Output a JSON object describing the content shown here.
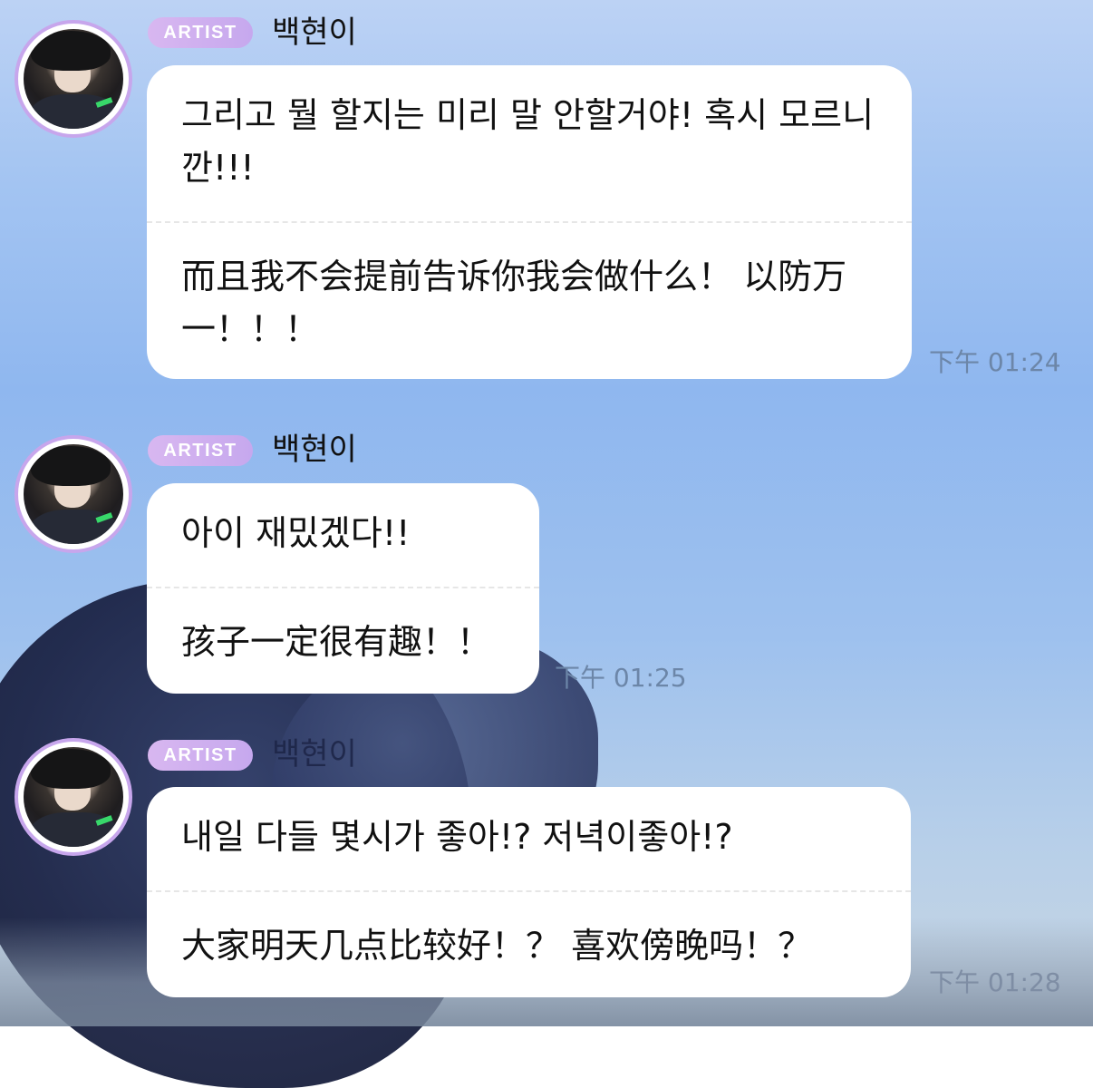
{
  "badge_label": "ARTIST",
  "messages": [
    {
      "sender": "백현이",
      "korean": "그리고 뭘 할지는 미리 말 안할거야! 혹시 모르니깐!!!",
      "chinese": "而且我不会提前告诉你我会做什么！ 以防万一！！！",
      "time": "下午 01:24"
    },
    {
      "sender": "백현이",
      "korean": "아이 재밌겠다!!",
      "chinese": "孩子一定很有趣！！",
      "time": "下午 01:25"
    },
    {
      "sender": "백현이",
      "korean": "내일 다들 몇시가 좋아!? 저녁이좋아!?",
      "chinese": "大家明天几点比较好！？ 喜欢傍晚吗！？",
      "time": "下午 01:28"
    }
  ],
  "colors": {
    "badge": "#c6a8ee",
    "avatar_ring": "#c7a6ec",
    "bubble": "#ffffff",
    "time": "#6c86a8"
  }
}
